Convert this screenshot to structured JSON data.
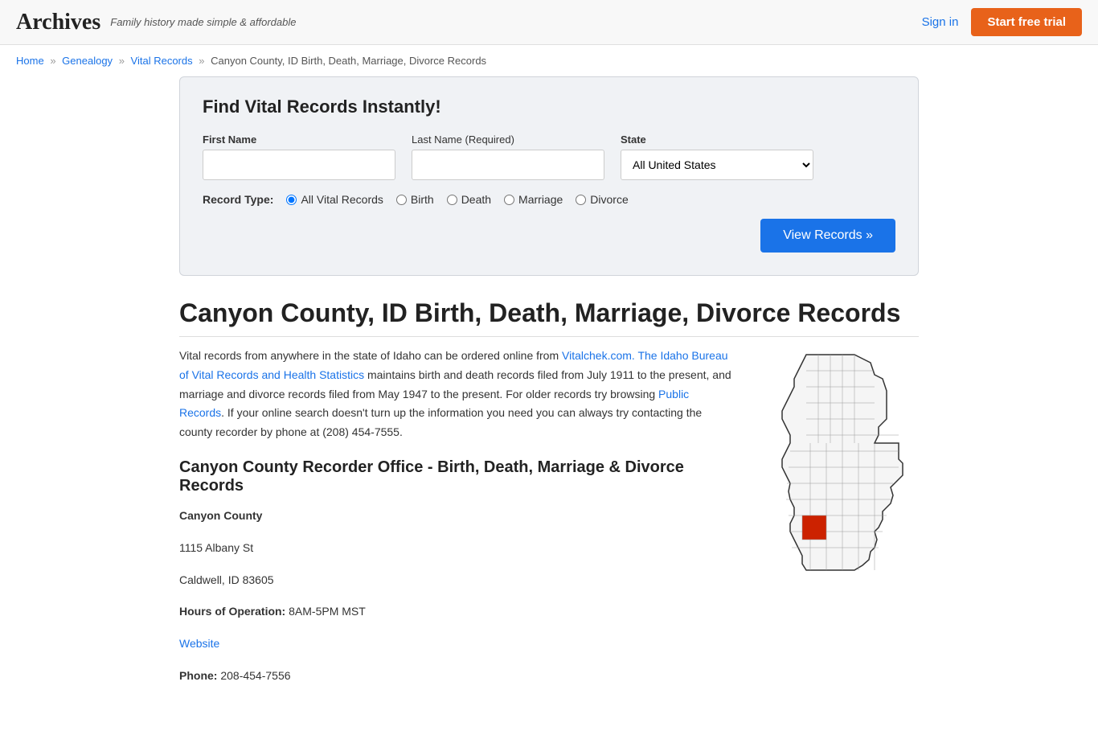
{
  "header": {
    "logo": "Archives",
    "tagline": "Family history made simple & affordable",
    "sign_in": "Sign in",
    "start_trial": "Start free trial"
  },
  "breadcrumb": {
    "home": "Home",
    "genealogy": "Genealogy",
    "vital_records": "Vital Records",
    "current": "Canyon County, ID Birth, Death, Marriage, Divorce Records"
  },
  "search": {
    "title": "Find Vital Records Instantly!",
    "first_name_label": "First Name",
    "last_name_label": "Last Name",
    "last_name_required": "(Required)",
    "state_label": "State",
    "state_default": "All United States",
    "record_type_label": "Record Type:",
    "record_types": [
      {
        "id": "all",
        "label": "All Vital Records",
        "checked": true
      },
      {
        "id": "birth",
        "label": "Birth",
        "checked": false
      },
      {
        "id": "death",
        "label": "Death",
        "checked": false
      },
      {
        "id": "marriage",
        "label": "Marriage",
        "checked": false
      },
      {
        "id": "divorce",
        "label": "Divorce",
        "checked": false
      }
    ],
    "view_records_btn": "View Records »"
  },
  "page": {
    "title": "Canyon County, ID Birth, Death, Marriage, Divorce Records",
    "intro": "Vital records from anywhere in the state of Idaho can be ordered online from Vitalchek.com. The Idaho Bureau of Vital Records and Health Statistics maintains birth and death records filed from July 1911 to the present, and marriage and divorce records filed from May 1947 to the present. For older records try browsing Public Records. If your online search doesn't turn up the information you need you can always try contacting the county recorder by phone at (208) 454-7555.",
    "vitalchek_link": "Vitalchek.com.",
    "idaho_bureau_link": "The Idaho Bureau of Vital Records and Health Statistics",
    "public_records_link": "Public Records",
    "recorder_section_title": "Canyon County Recorder Office - Birth, Death, Marriage & Divorce Records",
    "office": {
      "name": "Canyon County",
      "address1": "1115 Albany St",
      "address2": "Caldwell, ID 83605",
      "hours_label": "Hours of Operation:",
      "hours": "8AM-5PM MST",
      "website_label": "Website",
      "phone_label": "Phone:",
      "phone": "208-454-7556"
    }
  }
}
